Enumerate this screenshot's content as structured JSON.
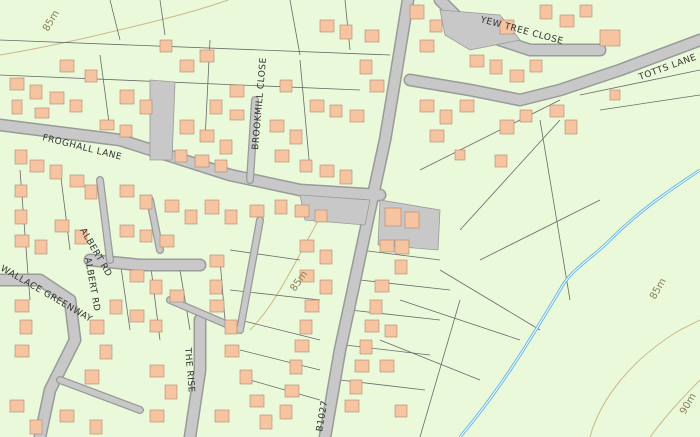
{
  "map": {
    "colors": {
      "background": "#e9f9d9",
      "road_fill": "#c8c8c8",
      "road_outline": "#9a9a9a",
      "building": "#f6c4a0",
      "building_outline": "#b08870",
      "parcel_line": "#6a6a6a",
      "water": "#66b8e6",
      "contour": "#c9b98a"
    },
    "street_labels": {
      "froghall_lane": "FROGHALL LANE",
      "brookmill_close": "BROOKMILL CLOSE",
      "yew_tree_close": "YEW TREE CLOSE",
      "totts_lane": "TOTTS LANE",
      "albert_rd": "ALBERT RD",
      "wallace_greenway": "WALLACE GREENWAY",
      "the_rise": "THE RISE",
      "b1027": "B1027",
      "small_road": "ALBERT RD"
    },
    "contour_labels": {
      "c85_upper_left": "85m",
      "c85_mid": "85m",
      "c85_right": "85m",
      "c90_bottom_right": "90m"
    }
  }
}
